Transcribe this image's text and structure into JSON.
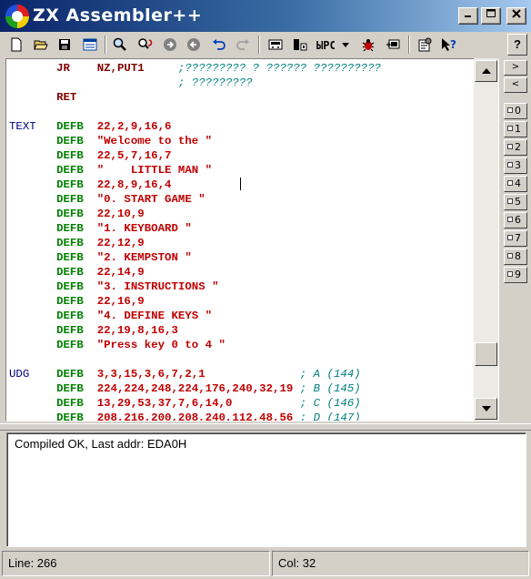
{
  "window": {
    "title": "ZX Assembler++",
    "minimize": "_",
    "maximize": "□",
    "close": "✕"
  },
  "toolbar": {
    "icons": [
      "new-file",
      "open-file",
      "save-file",
      "view-list",
      "find",
      "find-replace",
      "next",
      "previous",
      "undo",
      "redo",
      "build-tap",
      "build-bin",
      "build-options",
      "debug",
      "export",
      "properties",
      "context-help"
    ],
    "help_label": "?"
  },
  "editor": {
    "lines": [
      {
        "label": "",
        "op": "JR",
        "args": "NZ,PUT1",
        "arg_kind": "arg",
        "comment": ";????????? ? ?????? ??????????"
      },
      {
        "label": "",
        "op": "",
        "args": "",
        "arg_kind": "arg",
        "comment": "; ?????????"
      },
      {
        "label": "",
        "op": "RET",
        "args": "",
        "arg_kind": "arg",
        "comment": ""
      },
      {
        "label": "",
        "op": "",
        "args": "",
        "arg_kind": "arg",
        "comment": ""
      },
      {
        "label": "TEXT",
        "op": "DEFB",
        "args": "22,2,9,16,6",
        "arg_kind": "num",
        "comment": ""
      },
      {
        "label": "",
        "op": "DEFB",
        "args": "\"Welcome to the \"",
        "arg_kind": "str",
        "comment": ""
      },
      {
        "label": "",
        "op": "DEFB",
        "args": "22,5,7,16,7",
        "arg_kind": "num",
        "comment": ""
      },
      {
        "label": "",
        "op": "DEFB",
        "args": "\"    LITTLE MAN \"",
        "arg_kind": "str",
        "comment": ""
      },
      {
        "label": "",
        "op": "DEFB",
        "args": "22,8,9,16,4",
        "arg_kind": "num",
        "comment": ""
      },
      {
        "label": "",
        "op": "DEFB",
        "args": "\"0. START GAME \"",
        "arg_kind": "str",
        "comment": ""
      },
      {
        "label": "",
        "op": "DEFB",
        "args": "22,10,9",
        "arg_kind": "num",
        "comment": ""
      },
      {
        "label": "",
        "op": "DEFB",
        "args": "\"1. KEYBOARD \"",
        "arg_kind": "str",
        "comment": ""
      },
      {
        "label": "",
        "op": "DEFB",
        "args": "22,12,9",
        "arg_kind": "num",
        "comment": ""
      },
      {
        "label": "",
        "op": "DEFB",
        "args": "\"2. KEMPSTON \"",
        "arg_kind": "str",
        "comment": ""
      },
      {
        "label": "",
        "op": "DEFB",
        "args": "22,14,9",
        "arg_kind": "num",
        "comment": ""
      },
      {
        "label": "",
        "op": "DEFB",
        "args": "\"3. INSTRUCTIONS \"",
        "arg_kind": "str",
        "comment": ""
      },
      {
        "label": "",
        "op": "DEFB",
        "args": "22,16,9",
        "arg_kind": "num",
        "comment": ""
      },
      {
        "label": "",
        "op": "DEFB",
        "args": "\"4. DEFINE KEYS \"",
        "arg_kind": "str",
        "comment": ""
      },
      {
        "label": "",
        "op": "DEFB",
        "args": "22,19,8,16,3",
        "arg_kind": "num",
        "comment": ""
      },
      {
        "label": "",
        "op": "DEFB",
        "args": "\"Press key 0 to 4 \"",
        "arg_kind": "str",
        "comment": ""
      },
      {
        "label": "",
        "op": "",
        "args": "",
        "arg_kind": "arg",
        "comment": ""
      },
      {
        "label": "UDG",
        "op": "DEFB",
        "args": "3,3,15,3,6,7,2,1",
        "arg_kind": "num",
        "comment": "; A (144)"
      },
      {
        "label": "",
        "op": "DEFB",
        "args": "224,224,248,224,176,240,32,19",
        "arg_kind": "num",
        "comment": "; B (145)"
      },
      {
        "label": "",
        "op": "DEFB",
        "args": "13,29,53,37,7,6,14,0",
        "arg_kind": "num",
        "comment": "; C (146)"
      },
      {
        "label": "",
        "op": "DEFB",
        "args": "208,216,200,208,240,112,48,56",
        "arg_kind": "num",
        "comment": "; D (147)"
      }
    ]
  },
  "right_panel": {
    "nav": [
      ">",
      "<"
    ],
    "bookmarks": [
      "0",
      "1",
      "2",
      "3",
      "4",
      "5",
      "6",
      "7",
      "8",
      "9"
    ]
  },
  "output": {
    "message": "Compiled OK, Last addr: EDA0H"
  },
  "status": {
    "line": "Line: 266",
    "col": "Col: 32"
  }
}
